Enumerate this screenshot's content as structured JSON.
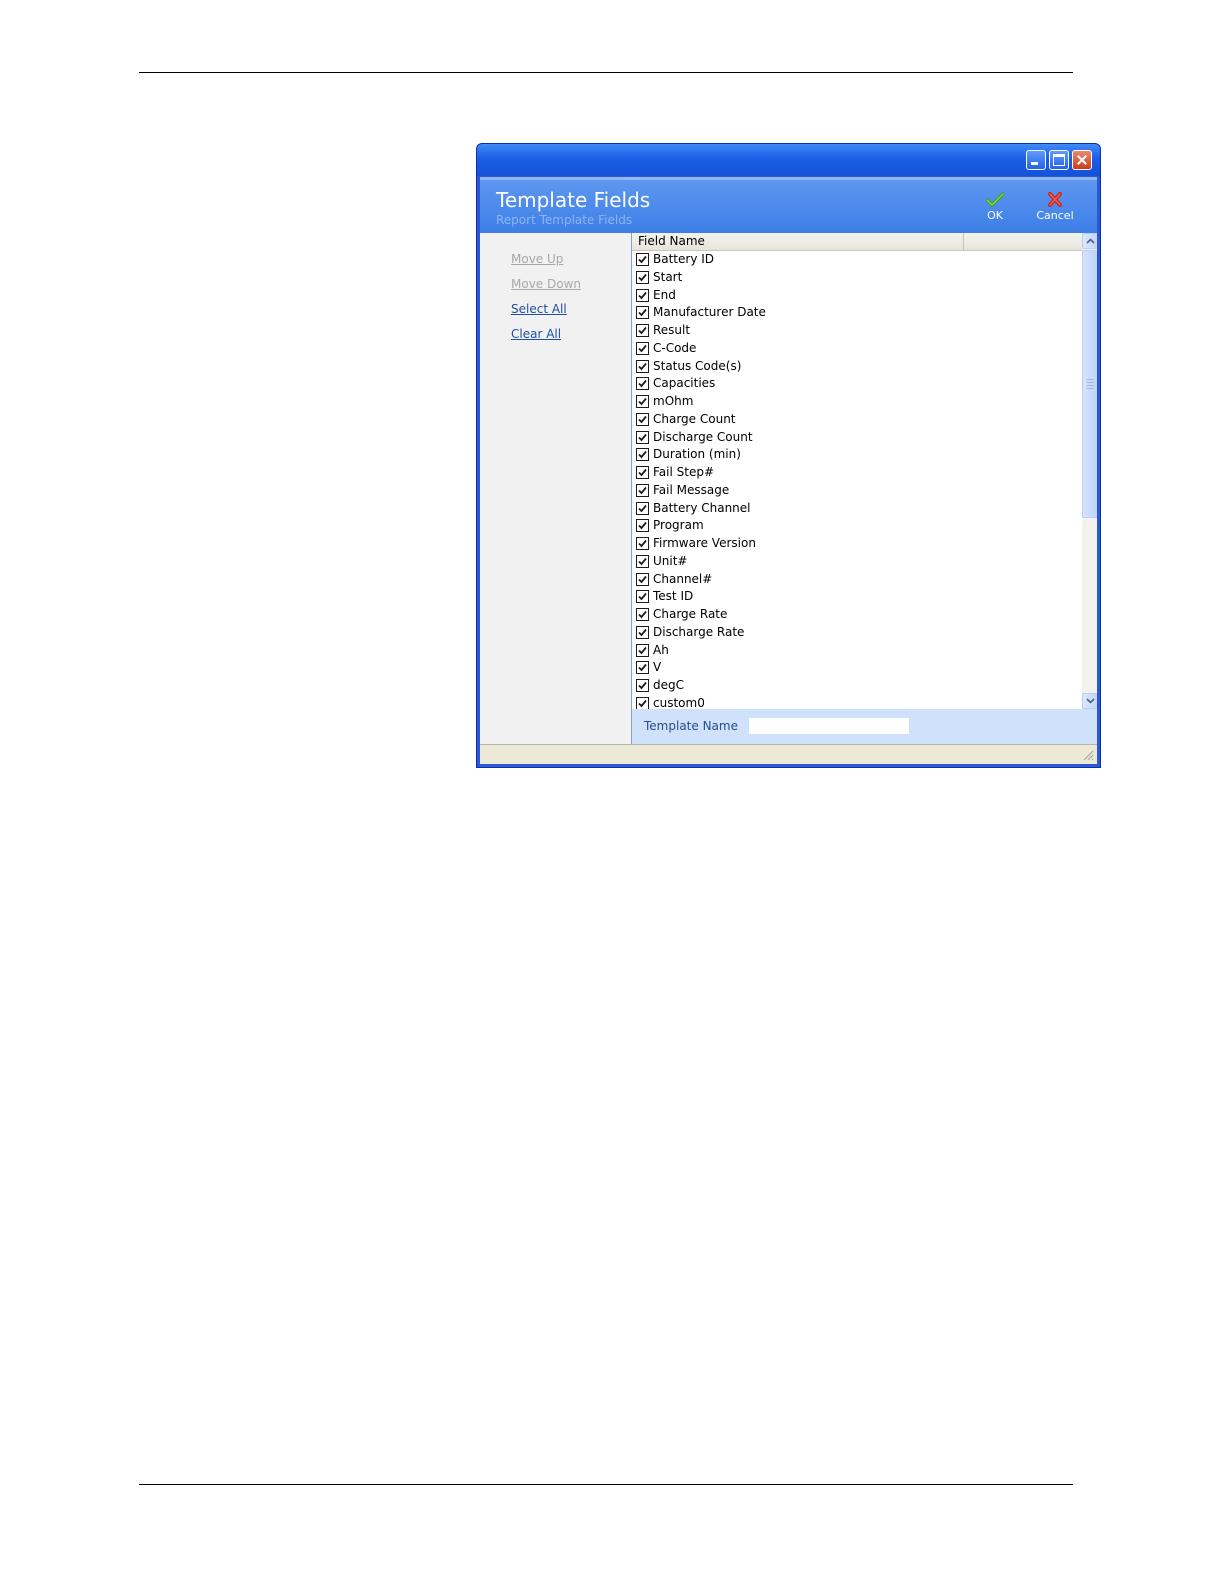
{
  "window": {
    "title": "",
    "header_title": "Template Fields",
    "header_subtitle": "Report Template Fields"
  },
  "actions": {
    "ok_label": "OK",
    "cancel_label": "Cancel"
  },
  "side_links": [
    {
      "label": "Move Up",
      "enabled": false
    },
    {
      "label": "Move Down",
      "enabled": false
    },
    {
      "label": "Select All",
      "enabled": true
    },
    {
      "label": "Clear All",
      "enabled": true
    }
  ],
  "list": {
    "columns": [
      "Field Name",
      ""
    ],
    "fields": [
      {
        "label": "Battery ID",
        "checked": true
      },
      {
        "label": "Start",
        "checked": true
      },
      {
        "label": "End",
        "checked": true
      },
      {
        "label": "Manufacturer Date",
        "checked": true
      },
      {
        "label": "Result",
        "checked": true
      },
      {
        "label": "C-Code",
        "checked": true
      },
      {
        "label": "Status Code(s)",
        "checked": true
      },
      {
        "label": "Capacities",
        "checked": true
      },
      {
        "label": "mOhm",
        "checked": true
      },
      {
        "label": "Charge Count",
        "checked": true
      },
      {
        "label": "Discharge Count",
        "checked": true
      },
      {
        "label": "Duration (min)",
        "checked": true
      },
      {
        "label": "Fail Step#",
        "checked": true
      },
      {
        "label": "Fail Message",
        "checked": true
      },
      {
        "label": "Battery Channel",
        "checked": true
      },
      {
        "label": "Program",
        "checked": true
      },
      {
        "label": "Firmware Version",
        "checked": true
      },
      {
        "label": "Unit#",
        "checked": true
      },
      {
        "label": "Channel#",
        "checked": true
      },
      {
        "label": "Test ID",
        "checked": true
      },
      {
        "label": "Charge Rate",
        "checked": true
      },
      {
        "label": "Discharge Rate",
        "checked": true
      },
      {
        "label": "Ah",
        "checked": true
      },
      {
        "label": "V",
        "checked": true
      },
      {
        "label": "degC",
        "checked": true
      },
      {
        "label": "custom0",
        "checked": true
      }
    ]
  },
  "template_name": {
    "label": "Template Name",
    "value": ""
  },
  "icons": {
    "ok": "check-icon",
    "cancel": "x-icon",
    "minimize": "minimize-icon",
    "maximize": "maximize-icon",
    "close": "close-icon"
  },
  "colors": {
    "title_bar": "#1c5ee6",
    "header": "#4a86ea",
    "link": "#1f4fa6",
    "disabled_link": "#a8a8a8",
    "name_bar": "#cfe1fb"
  }
}
